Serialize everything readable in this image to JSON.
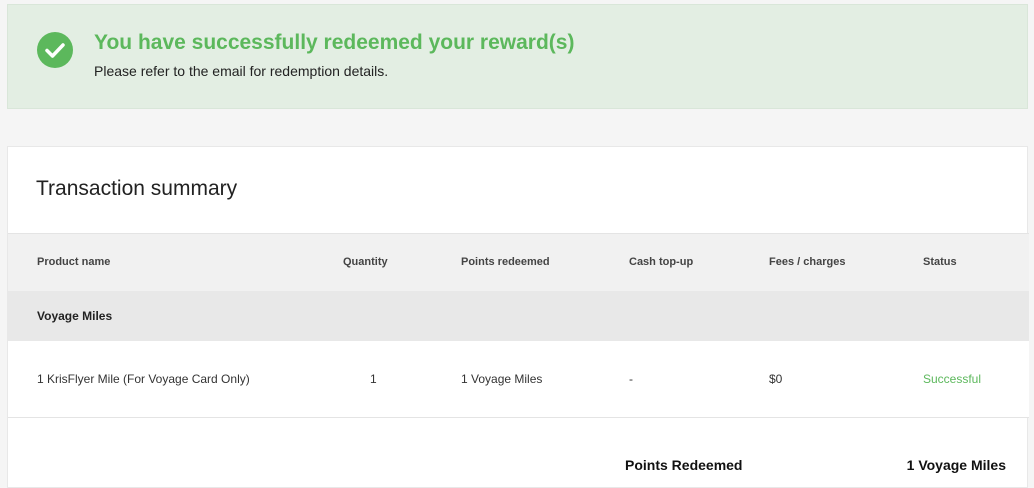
{
  "banner": {
    "title": "You have successfully redeemed your reward(s)",
    "subtitle": "Please refer to the email for redemption details.",
    "icon": "check-circle-icon",
    "accent_color": "#5cb85c"
  },
  "summary": {
    "title": "Transaction summary",
    "columns": [
      "Product name",
      "Quantity",
      "Points redeemed",
      "Cash top-up",
      "Fees / charges",
      "Status"
    ],
    "group_label": "Voyage Miles",
    "rows": [
      {
        "product": "1 KrisFlyer Mile (For Voyage Card Only)",
        "quantity": "1",
        "points": "1 Voyage Miles",
        "cash": "-",
        "fees": "$0",
        "status": "Successful"
      }
    ],
    "total_label": "Points Redeemed",
    "total_value": "1 Voyage Miles"
  }
}
